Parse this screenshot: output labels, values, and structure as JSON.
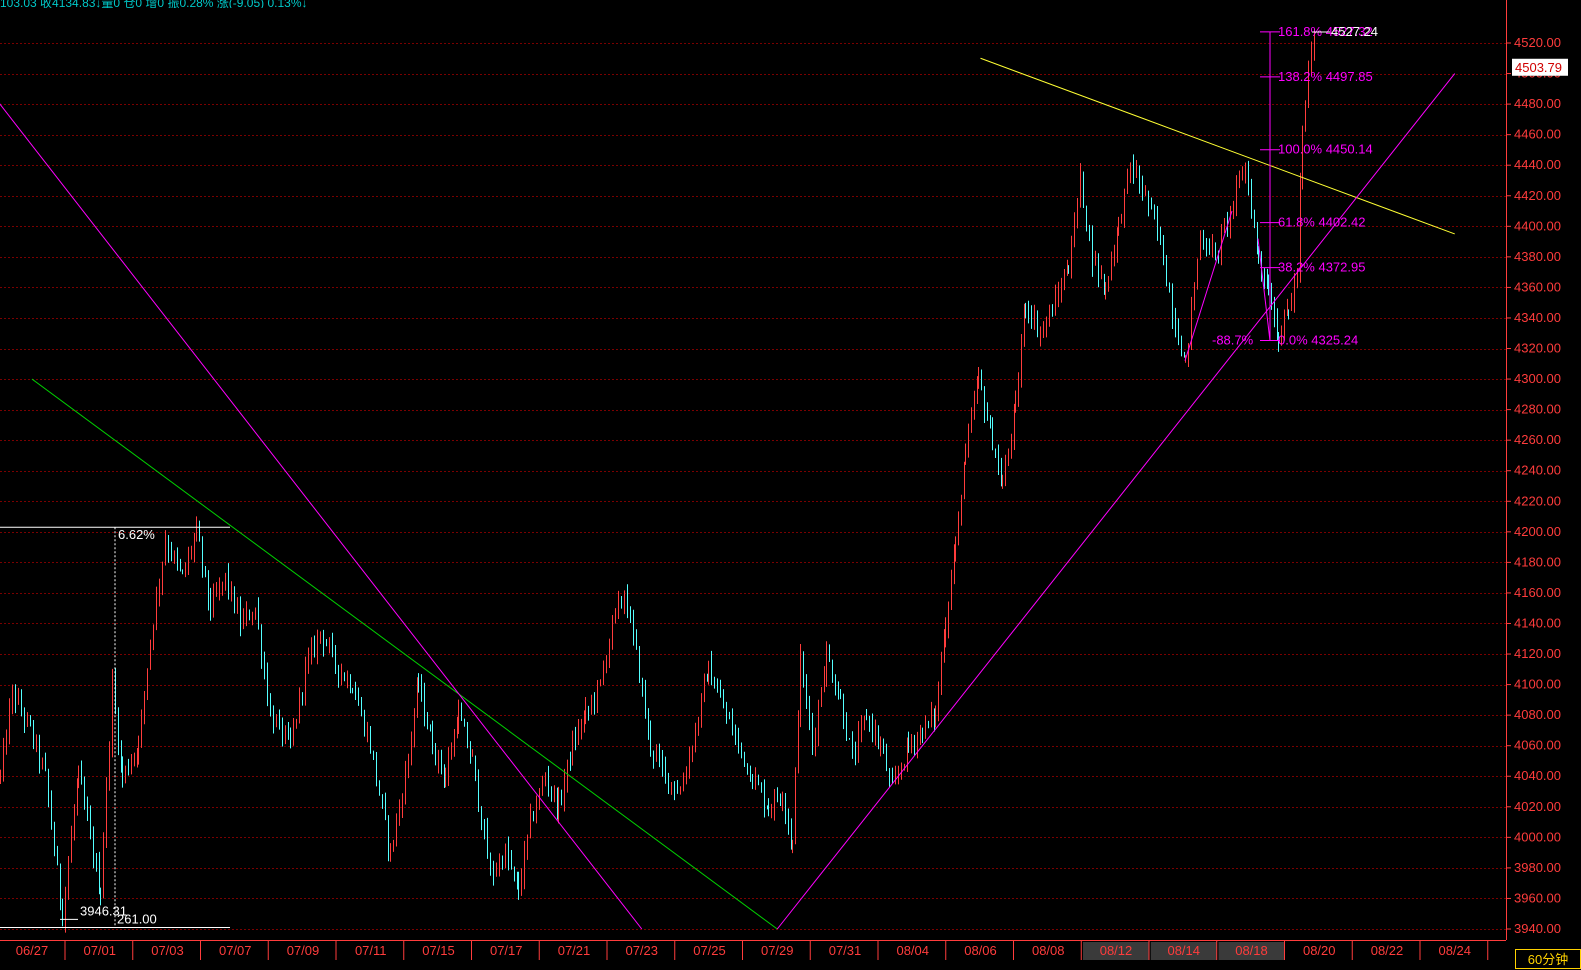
{
  "status_bar": {
    "text": "103.03 收4134.83↓量0 仓0 增0 振0.28% 涨(-9.05) 0.13%↓"
  },
  "period_button": {
    "label": "60分钟"
  },
  "colors": {
    "background": "#000000",
    "grid": "#7a0000",
    "candle_up": "#ff3c3c",
    "candle_down": "#54ffff",
    "channel": "#ff00ff",
    "yellow_line": "#ffff33",
    "green_line": "#00d000",
    "axis_text": "#ff3c3c",
    "label_white": "#ffffff"
  },
  "chart_data": {
    "type": "candlestick",
    "interval": "60min",
    "y_axis": {
      "min": 3940,
      "max": 4520,
      "step": 20,
      "position": "right",
      "ticks": [
        "4520.00",
        "4500.00",
        "4480.00",
        "4460.00",
        "4440.00",
        "4420.00",
        "4400.00",
        "4380.00",
        "4360.00",
        "4340.00",
        "4320.00",
        "4300.00",
        "4280.00",
        "4260.00",
        "4240.00",
        "4220.00",
        "4200.00",
        "4180.00",
        "4160.00",
        "4140.00",
        "4120.00",
        "4100.00",
        "4080.00",
        "4060.00",
        "4040.00",
        "4020.00",
        "4000.00",
        "3980.00",
        "3960.00",
        "3940.00"
      ]
    },
    "current_price": "4503.79",
    "x_axis": {
      "labels": [
        "06/27",
        "07/01",
        "07/03",
        "07/07",
        "07/09",
        "07/11",
        "07/15",
        "07/17",
        "07/21",
        "07/23",
        "07/25",
        "07/29",
        "07/31",
        "08/04",
        "08/06",
        "08/08",
        "08/12",
        "08/14",
        "08/18",
        "08/20",
        "08/22",
        "08/24"
      ],
      "highlighted": [
        "08/12",
        "08/14",
        "08/18"
      ]
    },
    "price_path": [
      [
        0,
        4040
      ],
      [
        12,
        4095
      ],
      [
        30,
        4070
      ],
      [
        45,
        4040
      ],
      [
        62,
        3950
      ],
      [
        78,
        4040
      ],
      [
        100,
        3965
      ],
      [
        112,
        4100
      ],
      [
        122,
        4040
      ],
      [
        138,
        4060
      ],
      [
        150,
        4130
      ],
      [
        165,
        4195
      ],
      [
        182,
        4170
      ],
      [
        196,
        4200
      ],
      [
        210,
        4150
      ],
      [
        225,
        4170
      ],
      [
        240,
        4140
      ],
      [
        255,
        4150
      ],
      [
        270,
        4080
      ],
      [
        290,
        4060
      ],
      [
        305,
        4110
      ],
      [
        320,
        4135
      ],
      [
        338,
        4110
      ],
      [
        352,
        4100
      ],
      [
        370,
        4060
      ],
      [
        390,
        3990
      ],
      [
        405,
        4040
      ],
      [
        418,
        4100
      ],
      [
        432,
        4060
      ],
      [
        445,
        4040
      ],
      [
        458,
        4080
      ],
      [
        472,
        4050
      ],
      [
        490,
        3975
      ],
      [
        505,
        3990
      ],
      [
        518,
        3965
      ],
      [
        530,
        4010
      ],
      [
        545,
        4040
      ],
      [
        558,
        4020
      ],
      [
        572,
        4060
      ],
      [
        585,
        4080
      ],
      [
        600,
        4100
      ],
      [
        612,
        4140
      ],
      [
        624,
        4160
      ],
      [
        636,
        4120
      ],
      [
        650,
        4060
      ],
      [
        665,
        4040
      ],
      [
        680,
        4030
      ],
      [
        695,
        4070
      ],
      [
        708,
        4110
      ],
      [
        720,
        4090
      ],
      [
        738,
        4060
      ],
      [
        752,
        4040
      ],
      [
        768,
        4020
      ],
      [
        782,
        4030
      ],
      [
        792,
        3995
      ],
      [
        800,
        4115
      ],
      [
        812,
        4060
      ],
      [
        826,
        4120
      ],
      [
        840,
        4090
      ],
      [
        852,
        4050
      ],
      [
        866,
        4080
      ],
      [
        880,
        4060
      ],
      [
        892,
        4030
      ],
      [
        908,
        4060
      ],
      [
        922,
        4070
      ],
      [
        935,
        4080
      ],
      [
        945,
        4140
      ],
      [
        955,
        4190
      ],
      [
        965,
        4250
      ],
      [
        978,
        4300
      ],
      [
        992,
        4260
      ],
      [
        1002,
        4230
      ],
      [
        1015,
        4280
      ],
      [
        1025,
        4350
      ],
      [
        1040,
        4330
      ],
      [
        1055,
        4350
      ],
      [
        1068,
        4375
      ],
      [
        1080,
        4430
      ],
      [
        1092,
        4380
      ],
      [
        1105,
        4360
      ],
      [
        1118,
        4400
      ],
      [
        1130,
        4440
      ],
      [
        1145,
        4420
      ],
      [
        1160,
        4390
      ],
      [
        1172,
        4345
      ],
      [
        1185,
        4310
      ],
      [
        1200,
        4395
      ],
      [
        1215,
        4380
      ],
      [
        1230,
        4410
      ],
      [
        1245,
        4440
      ],
      [
        1258,
        4380
      ],
      [
        1268,
        4360
      ],
      [
        1278,
        4328
      ],
      [
        1288,
        4345
      ],
      [
        1297,
        4370
      ],
      [
        1302,
        4460
      ],
      [
        1308,
        4500
      ],
      [
        1314,
        4527
      ],
      [
        1316,
        4504
      ]
    ],
    "trendlines": [
      {
        "name": "green-resistance",
        "color": "#00d000",
        "from": [
          "06/27",
          4300
        ],
        "to": [
          "07/29",
          3940
        ]
      },
      {
        "name": "yellow-resistance",
        "color": "#ffff33",
        "from": [
          "08/06",
          4510
        ],
        "to": [
          "08/24",
          4395
        ]
      },
      {
        "name": "channel-upper",
        "color": "#ff00ff",
        "from": [
          "07/23",
          3940
        ],
        "to": [
          "08/10",
          4510
        ]
      },
      {
        "name": "channel-lower",
        "color": "#ff00ff",
        "from": [
          "07/29",
          3940
        ],
        "to": [
          "08/24",
          4500
        ]
      }
    ],
    "range_measure": {
      "low": "3946.31",
      "high_pct": "6.62%",
      "bottom_label": "261.00"
    },
    "fibonacci": {
      "levels": [
        {
          "pct": "161.8%",
          "value": "4527.32"
        },
        {
          "pct": "138.2%",
          "value": "4497.85"
        },
        {
          "pct": "100.0%",
          "value": "4450.14"
        },
        {
          "pct": "61.8%",
          "value": "4402.42"
        },
        {
          "pct": "38.2%",
          "value": "4372.95"
        },
        {
          "pct": "0.0%",
          "value": "4325.24"
        }
      ],
      "retrace_label": "-88.7%",
      "high_label": "4527.24"
    }
  }
}
